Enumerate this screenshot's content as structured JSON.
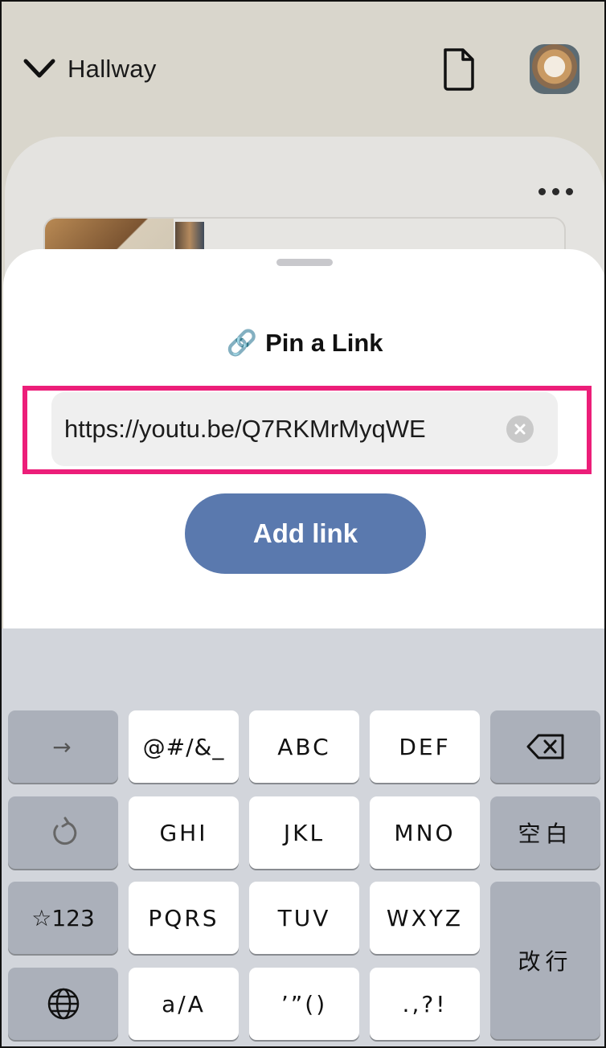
{
  "header": {
    "room_title": "Hallway",
    "icons": [
      "chevron-down-icon",
      "document-icon",
      "avatar"
    ]
  },
  "sheet": {
    "title": "Pin a Link",
    "title_emoji": "🔗",
    "url_value": "https://youtu.be/Q7RKMrMyqWE",
    "add_button_label": "Add link"
  },
  "keyboard": {
    "keys": {
      "next": "→",
      "symbols": "@#/&_",
      "abc": "ABC",
      "def": "DEF",
      "undo": "",
      "ghi": "GHI",
      "jkl": "JKL",
      "mno": "MNO",
      "space": "空白",
      "numbers": "☆123",
      "pqrs": "PQRS",
      "tuv": "TUV",
      "wxyz": "WXYZ",
      "return": "改行",
      "case": "a/A",
      "quotes": "’”()",
      "punct": ".,?!"
    }
  },
  "colors": {
    "accent_button": "#5a79ae",
    "highlight_box": "#ec1e79",
    "top_bar": "#d9d6cc",
    "keyboard_bg": "#d2d5db"
  }
}
